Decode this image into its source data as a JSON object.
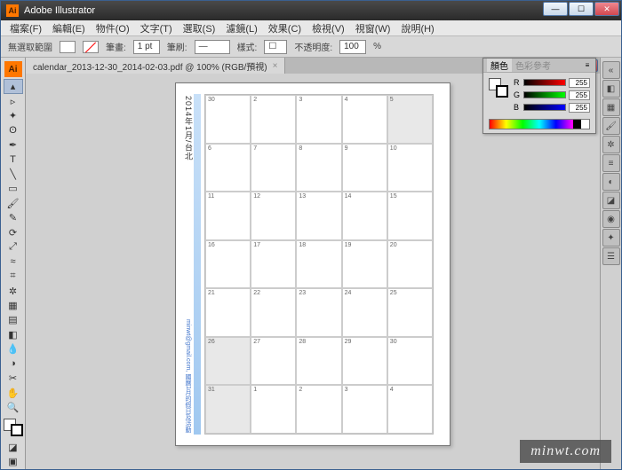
{
  "window": {
    "title": "Adobe Illustrator"
  },
  "menu": [
    "檔案(F)",
    "編輯(E)",
    "物件(O)",
    "文字(T)",
    "選取(S)",
    "濾鏡(L)",
    "效果(C)",
    "檢視(V)",
    "視窗(W)",
    "說明(H)"
  ],
  "controlbar": {
    "context": "無選取範圍",
    "stroke_label": "筆畫:",
    "stroke_value": "1 pt",
    "brush_label": "筆刷:",
    "style_label": "樣式:",
    "opacity_label": "不透明度:",
    "opacity_value": "100",
    "opacity_unit": "%"
  },
  "document": {
    "tab": "calendar_2013-12-30_2014-02-03.pdf @ 100% (RGB/預視)"
  },
  "calendar": {
    "title": "2014年1月/台北",
    "credit": "minwt@gmail.com, 國曆1月的假日及活動",
    "cells": [
      [
        30,
        2,
        3,
        4,
        5
      ],
      [
        6,
        7,
        8,
        9,
        10
      ],
      [
        11,
        12,
        13,
        14,
        15
      ],
      [
        16,
        17,
        18,
        19,
        20
      ],
      [
        21,
        22,
        23,
        24,
        25
      ],
      [
        26,
        27,
        28,
        29,
        30
      ],
      [
        31,
        1,
        2,
        3,
        4
      ]
    ],
    "shaded": [
      [
        0,
        4
      ],
      [
        5,
        0
      ],
      [
        6,
        0
      ]
    ]
  },
  "color_panel": {
    "tab1": "顏色",
    "tab2": "色彩參考",
    "r": 255,
    "g": 255,
    "b": 255
  },
  "watermark": "minwt.com"
}
